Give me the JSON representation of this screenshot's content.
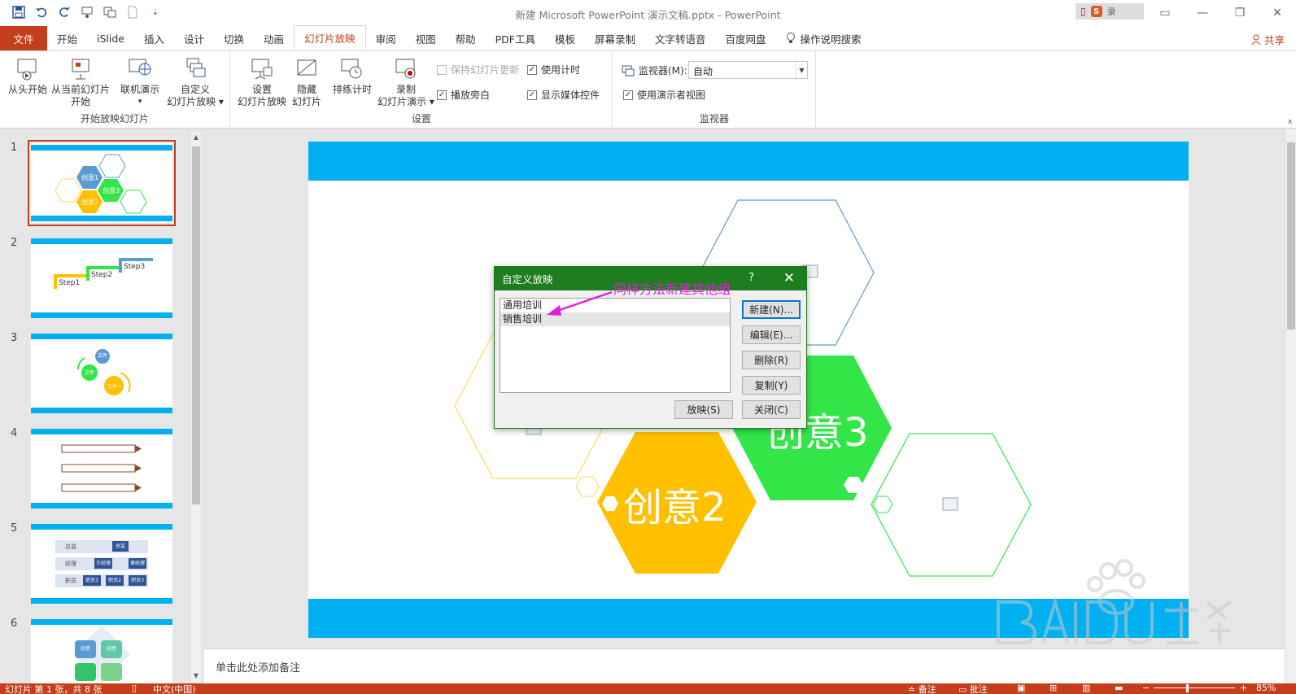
{
  "window": {
    "title": "新建 Microsoft PowerPoint 演示文稿.pptx  -  PowerPoint",
    "login_label": "录"
  },
  "tabs": [
    {
      "label": "文件"
    },
    {
      "label": "开始"
    },
    {
      "label": "iSlide"
    },
    {
      "label": "插入"
    },
    {
      "label": "设计"
    },
    {
      "label": "切换"
    },
    {
      "label": "动画"
    },
    {
      "label": "幻灯片放映"
    },
    {
      "label": "审阅"
    },
    {
      "label": "视图"
    },
    {
      "label": "帮助"
    },
    {
      "label": "PDF工具"
    },
    {
      "label": "模板"
    },
    {
      "label": "屏幕录制"
    },
    {
      "label": "文字转语音"
    },
    {
      "label": "百度网盘"
    },
    {
      "label": "操作说明搜索"
    }
  ],
  "share_label": "共享",
  "ribbon": {
    "start_group": {
      "label": "开始放映幻灯片",
      "from_start": "从头开始",
      "from_current_l1": "从当前幻灯片",
      "from_current_l2": "开始",
      "online_l1": "联机演示",
      "online_l2": "▾",
      "custom_l1": "自定义",
      "custom_l2": "幻灯片放映 ▾"
    },
    "setup_group": {
      "label": "设置",
      "setup_l1": "设置",
      "setup_l2": "幻灯片放映",
      "hide_l1": "隐藏",
      "hide_l2": "幻灯片",
      "rehearse": "排练计时",
      "record_l1": "录制",
      "record_l2": "幻灯片演示 ▾",
      "keep_updated": "保持幻灯片更新",
      "use_timings": "使用计时",
      "play_narrations": "播放旁白",
      "show_media": "显示媒体控件"
    },
    "monitor_group": {
      "label": "监视器",
      "monitor_label": "监视器(M):",
      "monitor_value": "自动",
      "presenter_view": "使用演示者视图"
    }
  },
  "thumbnails": [
    {
      "num": "1",
      "labels": [
        "创意1",
        "创意2",
        "创意3"
      ]
    },
    {
      "num": "2",
      "labels": [
        "Step1",
        "Step2",
        "Step3"
      ]
    },
    {
      "num": "3",
      "labels": [
        "文件",
        "文件",
        "文件一"
      ]
    },
    {
      "num": "4",
      "labels": []
    },
    {
      "num": "5",
      "labels": [
        "总监",
        "经理",
        "职员",
        "总监",
        "王经理",
        "黄经理",
        "职员1",
        "职员2",
        "职员3"
      ]
    },
    {
      "num": "6",
      "labels": [
        "创意",
        "创意"
      ]
    }
  ],
  "slide": {
    "hex_labels": {
      "c2": "创意2",
      "c3": "创意3"
    }
  },
  "notes_placeholder": "单击此处添加备注",
  "dialog": {
    "title": "自定义放映",
    "help": "?",
    "close": "✕",
    "items": [
      "通用培训",
      "销售培训"
    ],
    "buttons": {
      "new": "新建(N)...",
      "edit": "编辑(E)...",
      "delete": "删除(R)",
      "copy": "复制(Y)",
      "show": "放映(S)",
      "close": "关闭(C)"
    },
    "annotation": "同样方法新建其他组"
  },
  "status": {
    "slide_info": "幻灯片 第 1 张，共 8 张",
    "language": "中文(中国)",
    "notes": "备注",
    "comments": "批注",
    "zoom": "85%"
  },
  "colors": {
    "accent": "#c43e1c",
    "dialog_header": "#1e7d1e",
    "slide_bar": "#00b0f0",
    "hex_yellow": "#ffc000",
    "hex_green": "#33e648",
    "hex_blue": "#5b9bd5",
    "annotation": "#e020d8"
  }
}
